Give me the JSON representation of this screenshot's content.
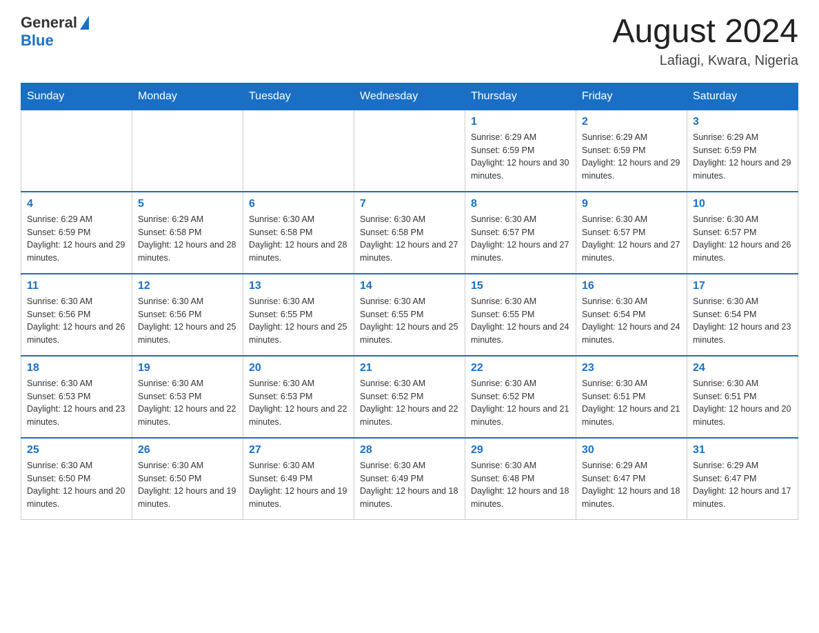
{
  "header": {
    "logo": {
      "general": "General",
      "blue": "Blue"
    },
    "title": "August 2024",
    "location": "Lafiagi, Kwara, Nigeria"
  },
  "weekdays": [
    "Sunday",
    "Monday",
    "Tuesday",
    "Wednesday",
    "Thursday",
    "Friday",
    "Saturday"
  ],
  "weeks": [
    [
      {
        "day": "",
        "info": ""
      },
      {
        "day": "",
        "info": ""
      },
      {
        "day": "",
        "info": ""
      },
      {
        "day": "",
        "info": ""
      },
      {
        "day": "1",
        "info": "Sunrise: 6:29 AM\nSunset: 6:59 PM\nDaylight: 12 hours and 30 minutes."
      },
      {
        "day": "2",
        "info": "Sunrise: 6:29 AM\nSunset: 6:59 PM\nDaylight: 12 hours and 29 minutes."
      },
      {
        "day": "3",
        "info": "Sunrise: 6:29 AM\nSunset: 6:59 PM\nDaylight: 12 hours and 29 minutes."
      }
    ],
    [
      {
        "day": "4",
        "info": "Sunrise: 6:29 AM\nSunset: 6:59 PM\nDaylight: 12 hours and 29 minutes."
      },
      {
        "day": "5",
        "info": "Sunrise: 6:29 AM\nSunset: 6:58 PM\nDaylight: 12 hours and 28 minutes."
      },
      {
        "day": "6",
        "info": "Sunrise: 6:30 AM\nSunset: 6:58 PM\nDaylight: 12 hours and 28 minutes."
      },
      {
        "day": "7",
        "info": "Sunrise: 6:30 AM\nSunset: 6:58 PM\nDaylight: 12 hours and 27 minutes."
      },
      {
        "day": "8",
        "info": "Sunrise: 6:30 AM\nSunset: 6:57 PM\nDaylight: 12 hours and 27 minutes."
      },
      {
        "day": "9",
        "info": "Sunrise: 6:30 AM\nSunset: 6:57 PM\nDaylight: 12 hours and 27 minutes."
      },
      {
        "day": "10",
        "info": "Sunrise: 6:30 AM\nSunset: 6:57 PM\nDaylight: 12 hours and 26 minutes."
      }
    ],
    [
      {
        "day": "11",
        "info": "Sunrise: 6:30 AM\nSunset: 6:56 PM\nDaylight: 12 hours and 26 minutes."
      },
      {
        "day": "12",
        "info": "Sunrise: 6:30 AM\nSunset: 6:56 PM\nDaylight: 12 hours and 25 minutes."
      },
      {
        "day": "13",
        "info": "Sunrise: 6:30 AM\nSunset: 6:55 PM\nDaylight: 12 hours and 25 minutes."
      },
      {
        "day": "14",
        "info": "Sunrise: 6:30 AM\nSunset: 6:55 PM\nDaylight: 12 hours and 25 minutes."
      },
      {
        "day": "15",
        "info": "Sunrise: 6:30 AM\nSunset: 6:55 PM\nDaylight: 12 hours and 24 minutes."
      },
      {
        "day": "16",
        "info": "Sunrise: 6:30 AM\nSunset: 6:54 PM\nDaylight: 12 hours and 24 minutes."
      },
      {
        "day": "17",
        "info": "Sunrise: 6:30 AM\nSunset: 6:54 PM\nDaylight: 12 hours and 23 minutes."
      }
    ],
    [
      {
        "day": "18",
        "info": "Sunrise: 6:30 AM\nSunset: 6:53 PM\nDaylight: 12 hours and 23 minutes."
      },
      {
        "day": "19",
        "info": "Sunrise: 6:30 AM\nSunset: 6:53 PM\nDaylight: 12 hours and 22 minutes."
      },
      {
        "day": "20",
        "info": "Sunrise: 6:30 AM\nSunset: 6:53 PM\nDaylight: 12 hours and 22 minutes."
      },
      {
        "day": "21",
        "info": "Sunrise: 6:30 AM\nSunset: 6:52 PM\nDaylight: 12 hours and 22 minutes."
      },
      {
        "day": "22",
        "info": "Sunrise: 6:30 AM\nSunset: 6:52 PM\nDaylight: 12 hours and 21 minutes."
      },
      {
        "day": "23",
        "info": "Sunrise: 6:30 AM\nSunset: 6:51 PM\nDaylight: 12 hours and 21 minutes."
      },
      {
        "day": "24",
        "info": "Sunrise: 6:30 AM\nSunset: 6:51 PM\nDaylight: 12 hours and 20 minutes."
      }
    ],
    [
      {
        "day": "25",
        "info": "Sunrise: 6:30 AM\nSunset: 6:50 PM\nDaylight: 12 hours and 20 minutes."
      },
      {
        "day": "26",
        "info": "Sunrise: 6:30 AM\nSunset: 6:50 PM\nDaylight: 12 hours and 19 minutes."
      },
      {
        "day": "27",
        "info": "Sunrise: 6:30 AM\nSunset: 6:49 PM\nDaylight: 12 hours and 19 minutes."
      },
      {
        "day": "28",
        "info": "Sunrise: 6:30 AM\nSunset: 6:49 PM\nDaylight: 12 hours and 18 minutes."
      },
      {
        "day": "29",
        "info": "Sunrise: 6:30 AM\nSunset: 6:48 PM\nDaylight: 12 hours and 18 minutes."
      },
      {
        "day": "30",
        "info": "Sunrise: 6:29 AM\nSunset: 6:47 PM\nDaylight: 12 hours and 18 minutes."
      },
      {
        "day": "31",
        "info": "Sunrise: 6:29 AM\nSunset: 6:47 PM\nDaylight: 12 hours and 17 minutes."
      }
    ]
  ]
}
